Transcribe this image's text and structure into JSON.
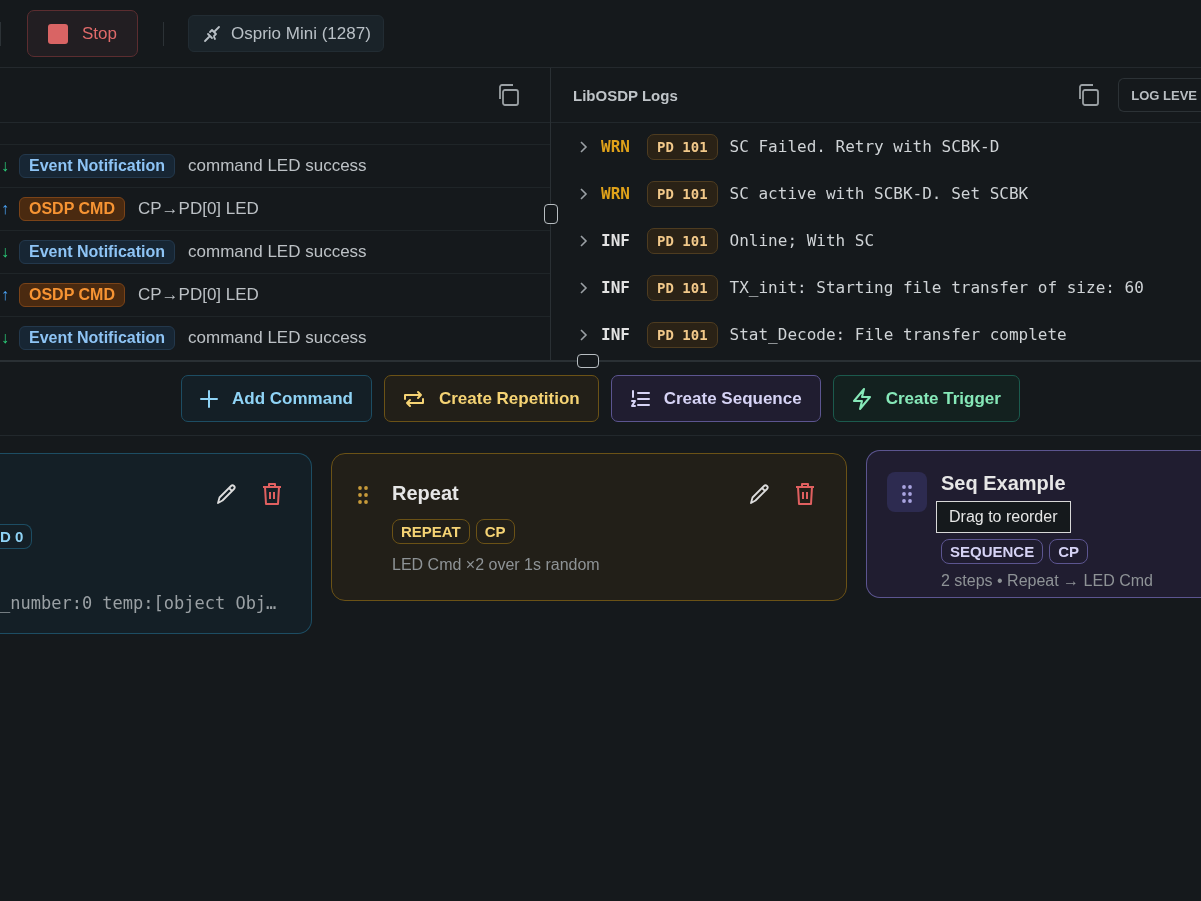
{
  "toolbar": {
    "stop_button": "Stop",
    "device": "Osprio Mini (1287)"
  },
  "packet_log": {
    "rows": [
      {
        "arrow": "↓",
        "kind": "event",
        "tag": "Event Notification",
        "text": "command LED success"
      },
      {
        "arrow": "↑",
        "kind": "command",
        "tag": "OSDP CMD",
        "text": "CP→PD[0] LED"
      },
      {
        "arrow": "↓",
        "kind": "event",
        "tag": "Event Notification",
        "text": "command LED success"
      },
      {
        "arrow": "↑",
        "kind": "command",
        "tag": "OSDP CMD",
        "text": "CP→PD[0] LED"
      },
      {
        "arrow": "↓",
        "kind": "event",
        "tag": "Event Notification",
        "text": "command LED success"
      }
    ]
  },
  "libosdp_logs": {
    "title": "LibOSDP Logs",
    "log_level_button": "LOG LEVE",
    "rows": [
      {
        "level": "WRN",
        "source": "PD 101",
        "message": "SC Failed. Retry with SCBK-D"
      },
      {
        "level": "WRN",
        "source": "PD 101",
        "message": "SC active with SCBK-D. Set SCBK"
      },
      {
        "level": "INF",
        "source": "PD 101",
        "message": "Online; With SC"
      },
      {
        "level": "INF",
        "source": "PD 101",
        "message": "TX_init: Starting file transfer of size: 60"
      },
      {
        "level": "INF",
        "source": "PD 101",
        "message": "Stat_Decode: File transfer complete"
      }
    ]
  },
  "actions": [
    {
      "kind": "command",
      "label": "Add Command"
    },
    {
      "kind": "repetition",
      "label": "Create Repetition"
    },
    {
      "kind": "sequence",
      "label": "Create Sequence"
    },
    {
      "kind": "trigger",
      "label": "Create Trigger"
    }
  ],
  "cards": [
    {
      "kind": "command",
      "badges": [
        "D 0"
      ],
      "detail": "_number:0 temp:[object Obj…"
    },
    {
      "kind": "repetition",
      "title": "Repeat",
      "badges": [
        "REPEAT",
        "CP"
      ],
      "detail": "LED Cmd ×2 over 1s random"
    },
    {
      "kind": "sequence",
      "title": "Seq Example",
      "badges": [
        "SEQUENCE",
        "CP"
      ],
      "detail": "2 steps • Repeat → LED Cmd",
      "tooltip": "Drag to reorder"
    }
  ]
}
